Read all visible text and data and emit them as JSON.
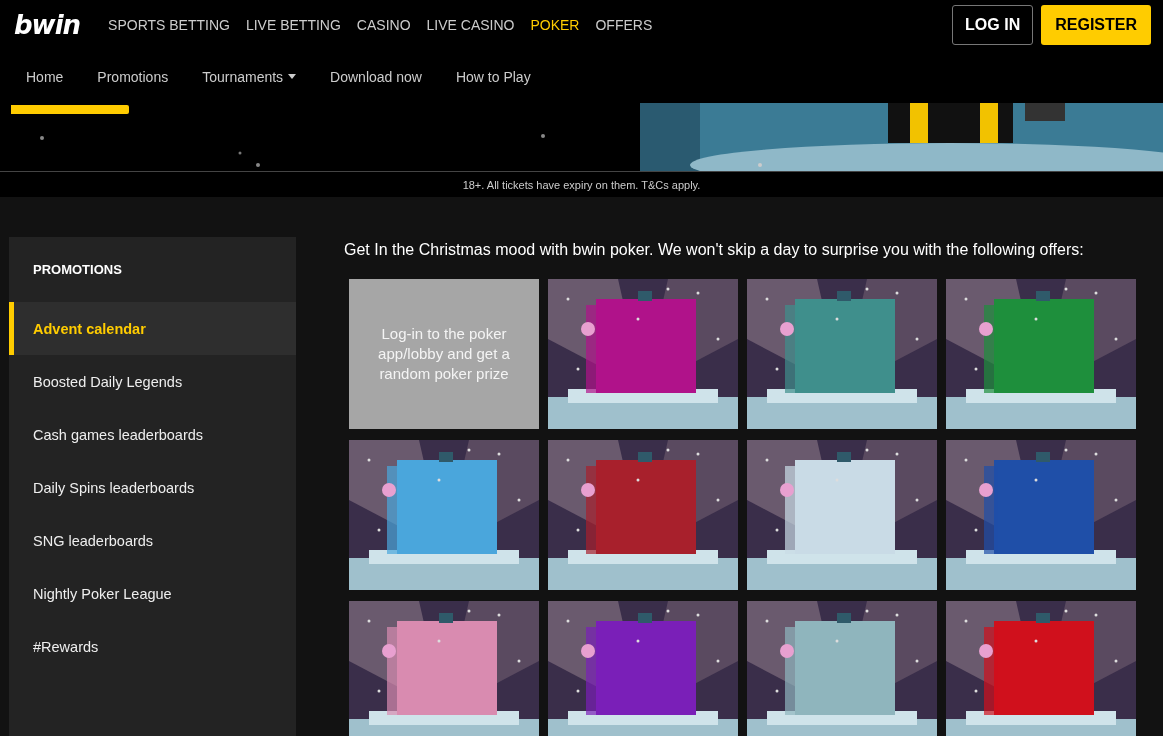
{
  "header": {
    "logo": "bwin",
    "nav": [
      {
        "label": "SPORTS BETTING",
        "selected": false
      },
      {
        "label": "LIVE BETTING",
        "selected": false
      },
      {
        "label": "CASINO",
        "selected": false
      },
      {
        "label": "LIVE CASINO",
        "selected": false
      },
      {
        "label": "POKER",
        "selected": true
      },
      {
        "label": "OFFERS",
        "selected": false
      }
    ],
    "login": "LOG IN",
    "register": "REGISTER"
  },
  "subnav": [
    {
      "label": "Home",
      "selected": true,
      "dropdown": false
    },
    {
      "label": "Promotions",
      "selected": false,
      "dropdown": false
    },
    {
      "label": "Tournaments",
      "selected": false,
      "dropdown": true
    },
    {
      "label": "Download now",
      "selected": false,
      "dropdown": false
    },
    {
      "label": "How to Play",
      "selected": false,
      "dropdown": false
    }
  ],
  "banner": {
    "kind": "picture",
    "notice": "18+. All tickets have expiry on them. T&Cs apply."
  },
  "sidebar": {
    "title": "PROMOTIONS",
    "items": [
      {
        "label": "Advent calendar",
        "selected": true
      },
      {
        "label": "Boosted Daily Legends",
        "selected": false
      },
      {
        "label": "Cash games leaderboards",
        "selected": false
      },
      {
        "label": "Daily Spins leaderboards",
        "selected": false
      },
      {
        "label": "SNG leaderboards",
        "selected": false
      },
      {
        "label": "Nightly Poker League",
        "selected": false
      },
      {
        "label": "#Rewards",
        "selected": false
      }
    ]
  },
  "content": {
    "intro": "Get In the Christmas mood with bwin poker. We won't skip a day to surprise you with the following offers:",
    "tiles": [
      {
        "kind": "text",
        "text": "Log-in to the poker app/lobby and get a random poker prize"
      },
      {
        "kind": "picture"
      },
      {
        "kind": "picture"
      },
      {
        "kind": "picture"
      },
      {
        "kind": "picture"
      },
      {
        "kind": "picture"
      },
      {
        "kind": "picture"
      },
      {
        "kind": "picture"
      },
      {
        "kind": "picture"
      },
      {
        "kind": "picture"
      },
      {
        "kind": "picture"
      },
      {
        "kind": "picture"
      }
    ]
  }
}
